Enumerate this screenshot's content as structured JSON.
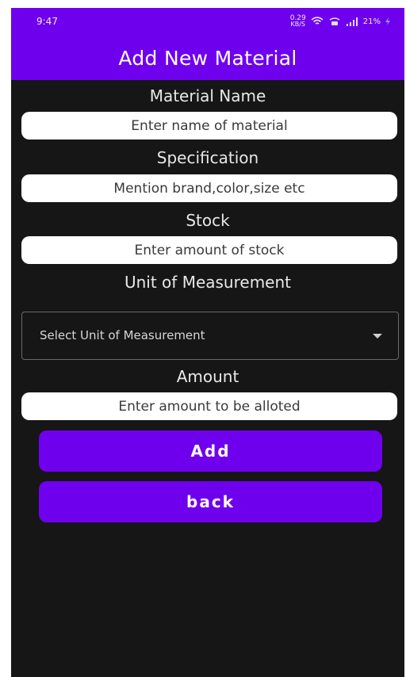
{
  "status_bar": {
    "time": "9:47",
    "net_speed_value": "0.29",
    "net_speed_unit": "KB/S",
    "battery": "21%",
    "icons": [
      "wifi-icon",
      "volte-icon",
      "signal-icon",
      "charging-icon"
    ]
  },
  "app_bar": {
    "title": "Add New Material"
  },
  "form": {
    "material_name_label": "Material Name",
    "material_name_placeholder": "Enter name of material",
    "specification_label": "Specification",
    "specification_placeholder": "Mention brand,color,size etc",
    "stock_label": "Stock",
    "stock_placeholder": "Enter amount of stock",
    "unit_label": "Unit of Measurement",
    "unit_select_value": "Select Unit of Measurement",
    "amount_label": "Amount",
    "amount_placeholder": "Enter amount to be alloted"
  },
  "buttons": {
    "add_label": "Add",
    "back_label": "back"
  },
  "colors": {
    "accent": "#6f00ee",
    "background": "#161616",
    "input_background": "#ffffff"
  }
}
